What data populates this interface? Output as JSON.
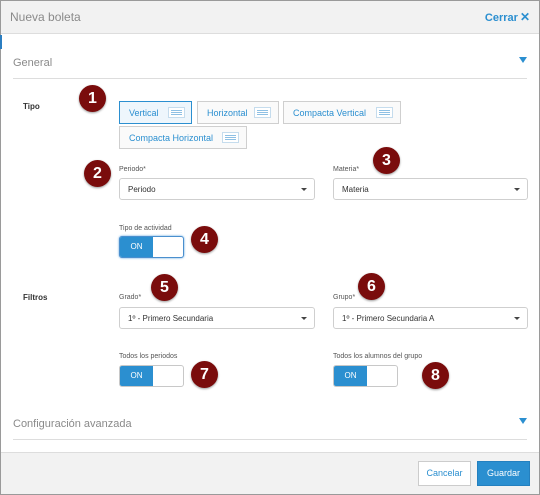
{
  "dialog": {
    "title": "Nueva boleta",
    "close_label": "Cerrar"
  },
  "general": {
    "title": "General",
    "tipo_label": "Tipo",
    "layouts": [
      "Vertical",
      "Horizontal",
      "Compacta Vertical",
      "Compacta Horizontal"
    ],
    "selected_layout": "Vertical",
    "periodo": {
      "label": "Periodo*",
      "value": "Periodo"
    },
    "materia": {
      "label": "Materia*",
      "value": "Materia"
    },
    "tipo_actividad": {
      "label": "Tipo de actividad",
      "state": "ON"
    },
    "filtros_label": "Filtros",
    "grado": {
      "label": "Grado*",
      "value": "1º - Primero Secundaria"
    },
    "grupo": {
      "label": "Grupo*",
      "value": "1º - Primero Secundaria A"
    },
    "todos_periodos": {
      "label": "Todos los periodos",
      "state": "ON"
    },
    "todos_alumnos": {
      "label": "Todos los alumnos del grupo",
      "state": "ON"
    }
  },
  "advanced": {
    "title": "Configuración avanzada"
  },
  "markers": [
    "1",
    "2",
    "3",
    "4",
    "5",
    "6",
    "7",
    "8"
  ],
  "footer": {
    "cancel_label": "Cancelar",
    "save_label": "Guardar"
  },
  "colors": {
    "accent": "#2b8fd0",
    "marker": "#7a0c0c"
  },
  "icons": {
    "close": "close-icon",
    "collapse": "caret-down-icon",
    "layout": "layout-lines-icon",
    "dropdown": "chevron-down-icon"
  }
}
